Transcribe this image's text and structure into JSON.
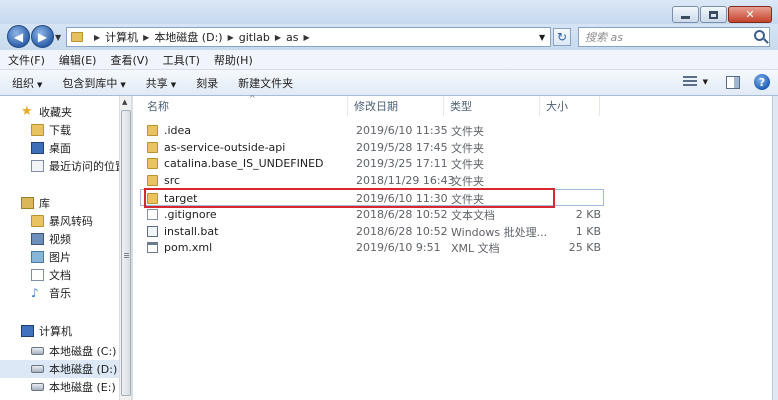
{
  "address": {
    "crumbs": [
      "计算机",
      "本地磁盘 (D:)",
      "gitlab",
      "as"
    ]
  },
  "search": {
    "placeholder": "搜索 as"
  },
  "menu": [
    "文件(F)",
    "编辑(E)",
    "查看(V)",
    "工具(T)",
    "帮助(H)"
  ],
  "toolbar": {
    "organize": "组织",
    "include": "包含到库中",
    "share": "共享",
    "burn": "刻录",
    "new_folder": "新建文件夹"
  },
  "nav": {
    "favorites": "收藏夹",
    "downloads": "下载",
    "desktop": "桌面",
    "recent": "最近访问的位置",
    "libraries": "库",
    "storm": "暴风转码",
    "videos": "视频",
    "pictures": "图片",
    "documents": "文档",
    "music": "音乐",
    "computer": "计算机",
    "drive_c": "本地磁盘 (C:)",
    "drive_d": "本地磁盘 (D:)",
    "drive_e": "本地磁盘 (E:)"
  },
  "columns": {
    "name": "名称",
    "date": "修改日期",
    "type": "类型",
    "size": "大小"
  },
  "files": [
    {
      "name": ".idea",
      "date": "2019/6/10 11:35",
      "type": "文件夹",
      "size": "",
      "icon": "folder"
    },
    {
      "name": "as-service-outside-api",
      "date": "2019/5/28 17:45",
      "type": "文件夹",
      "size": "",
      "icon": "folder"
    },
    {
      "name": "catalina.base_IS_UNDEFINED",
      "date": "2019/3/25 17:11",
      "type": "文件夹",
      "size": "",
      "icon": "folder"
    },
    {
      "name": "src",
      "date": "2018/11/29 16:43",
      "type": "文件夹",
      "size": "",
      "icon": "folder"
    },
    {
      "name": "target",
      "date": "2019/6/10 11:30",
      "type": "文件夹",
      "size": "",
      "icon": "folder"
    },
    {
      "name": ".gitignore",
      "date": "2018/6/28 10:52",
      "type": "文本文档",
      "size": "2 KB",
      "icon": "text"
    },
    {
      "name": "install.bat",
      "date": "2018/6/28 10:52",
      "type": "Windows 批处理...",
      "size": "1 KB",
      "icon": "bat"
    },
    {
      "name": "pom.xml",
      "date": "2019/6/10 9:51",
      "type": "XML 文档",
      "size": "25 KB",
      "icon": "xml"
    }
  ]
}
